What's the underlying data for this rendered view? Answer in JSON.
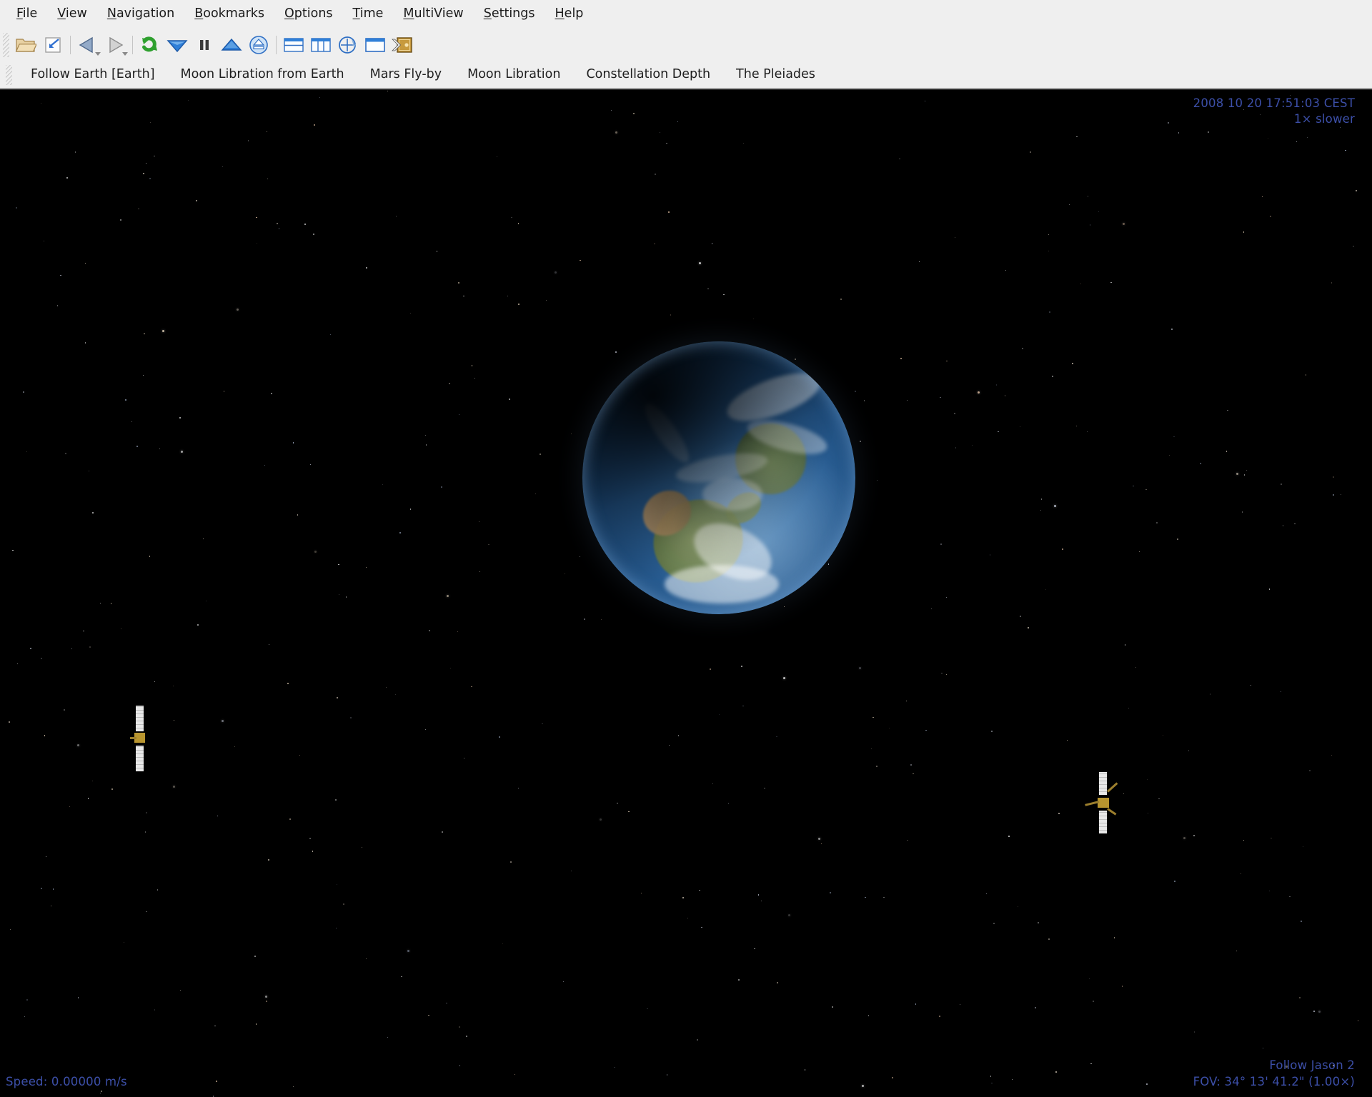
{
  "app": {
    "name": "Celestia"
  },
  "menubar": {
    "items": [
      {
        "label": "File",
        "mnemonic": "F"
      },
      {
        "label": "View",
        "mnemonic": "V"
      },
      {
        "label": "Navigation",
        "mnemonic": "N"
      },
      {
        "label": "Bookmarks",
        "mnemonic": "B"
      },
      {
        "label": "Options",
        "mnemonic": "O"
      },
      {
        "label": "Time",
        "mnemonic": "T"
      },
      {
        "label": "MultiView",
        "mnemonic": "M"
      },
      {
        "label": "Settings",
        "mnemonic": "S"
      },
      {
        "label": "Help",
        "mnemonic": "H"
      }
    ]
  },
  "toolbar": {
    "buttons": [
      {
        "name": "open-script-icon",
        "title": "Open Script"
      },
      {
        "name": "capture-image-icon",
        "title": "Capture Image"
      },
      {
        "name": "reverse-time-icon",
        "title": "Reverse Time"
      },
      {
        "name": "play-time-icon",
        "title": "Play Forward"
      },
      {
        "name": "reload-icon",
        "title": "Reload"
      },
      {
        "name": "slower-icon",
        "title": "Slow Down Time"
      },
      {
        "name": "pause-icon",
        "title": "Pause Time"
      },
      {
        "name": "faster-icon",
        "title": "Speed Up Time"
      },
      {
        "name": "real-time-icon",
        "title": "Real Time"
      },
      {
        "name": "split-horizontally-icon",
        "title": "Split Horizontally"
      },
      {
        "name": "split-vertically-icon",
        "title": "Split Vertically"
      },
      {
        "name": "cycle-view-icon",
        "title": "Cycle View"
      },
      {
        "name": "single-view-icon",
        "title": "Single View"
      },
      {
        "name": "console-icon",
        "title": "Celestial Browser"
      }
    ]
  },
  "bookmarks": {
    "items": [
      {
        "label": "Follow Earth [Earth]"
      },
      {
        "label": "Moon Libration from Earth"
      },
      {
        "label": "Mars Fly-by"
      },
      {
        "label": "Moon Libration"
      },
      {
        "label": "Constellation Depth"
      },
      {
        "label": "The Pleiades"
      }
    ]
  },
  "overlay": {
    "time": "2008 10 20 17:51:03 CEST",
    "time_rate": "1× slower",
    "speed": "Speed: 0.00000 m/s",
    "follow_target": "Follow Jason 2",
    "fov": "FOV: 34° 13' 41.2\" (1.00×)",
    "text_color": "#3c4fa8"
  },
  "scene": {
    "objects": [
      {
        "name": "earth",
        "label": "Earth"
      },
      {
        "name": "satellite-left",
        "label": "Satellite"
      },
      {
        "name": "satellite-right",
        "label": "Jason 2"
      }
    ]
  }
}
